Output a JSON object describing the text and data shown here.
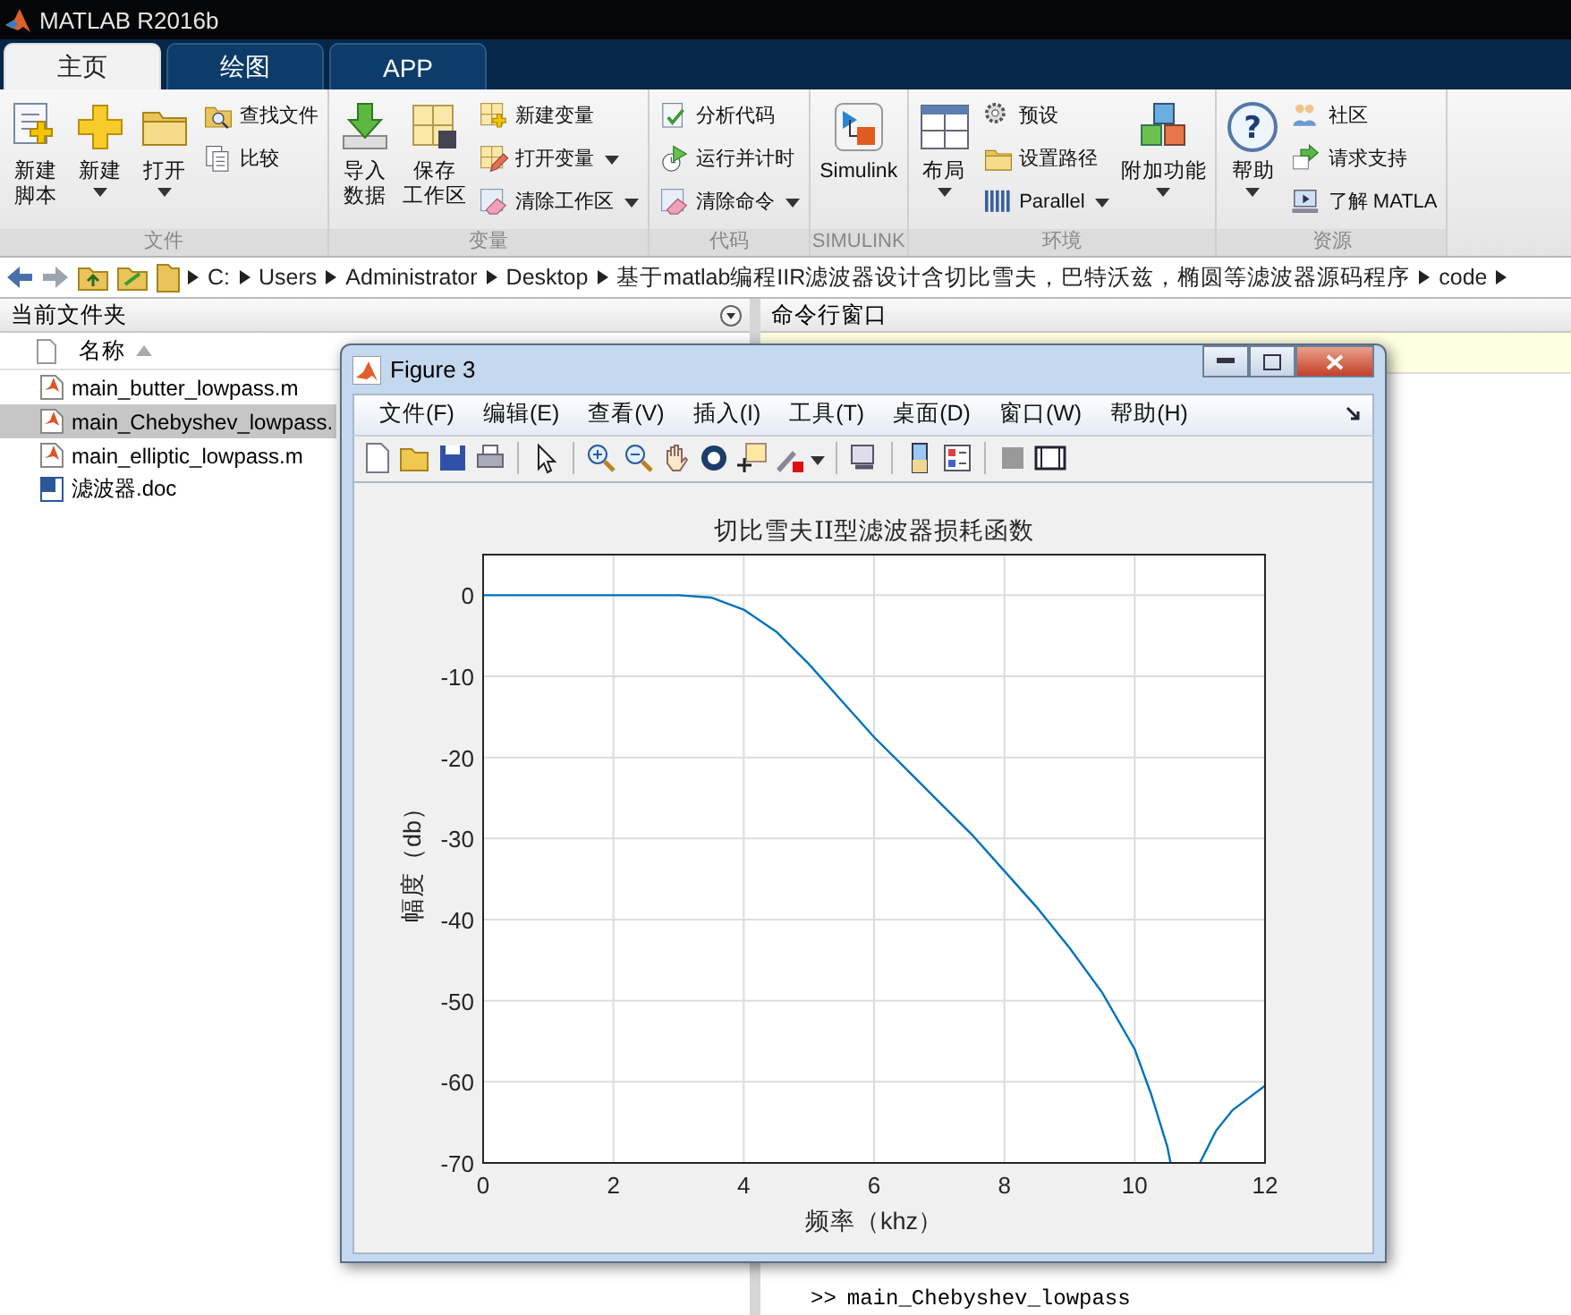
{
  "window": {
    "title": "MATLAB R2016b"
  },
  "tabs": [
    {
      "label": "主页",
      "selected": true
    },
    {
      "label": "绘图",
      "selected": false
    },
    {
      "label": "APP",
      "selected": false
    }
  ],
  "ribbon": [
    {
      "label": "文件",
      "items": [
        {
          "lines": [
            "新建",
            "脚本"
          ],
          "kind": "large",
          "dropdown": false
        },
        {
          "lines": [
            "新建"
          ],
          "kind": "large",
          "dropdown": true
        },
        {
          "lines": [
            "打开"
          ],
          "kind": "large",
          "dropdown": true
        },
        {
          "lines": [
            "查找文件"
          ],
          "kind": "small",
          "dropdown": false
        },
        {
          "lines": [
            "比较"
          ],
          "kind": "small",
          "dropdown": false
        }
      ]
    },
    {
      "label": "变量",
      "items": [
        {
          "lines": [
            "导入",
            "数据"
          ],
          "kind": "large",
          "dropdown": false
        },
        {
          "lines": [
            "保存",
            "工作区"
          ],
          "kind": "large",
          "dropdown": false
        },
        {
          "lines": [
            "新建变量"
          ],
          "kind": "small",
          "dropdown": false
        },
        {
          "lines": [
            "打开变量"
          ],
          "kind": "small",
          "dropdown": true
        },
        {
          "lines": [
            "清除工作区"
          ],
          "kind": "small",
          "dropdown": true
        }
      ]
    },
    {
      "label": "代码",
      "items": [
        {
          "lines": [
            "分析代码"
          ],
          "kind": "small",
          "dropdown": false
        },
        {
          "lines": [
            "运行并计时"
          ],
          "kind": "small",
          "dropdown": false
        },
        {
          "lines": [
            "清除命令"
          ],
          "kind": "small",
          "dropdown": true
        }
      ]
    },
    {
      "label": "SIMULINK",
      "items": [
        {
          "lines": [
            "Simulink"
          ],
          "kind": "large",
          "dropdown": false
        }
      ]
    },
    {
      "label": "环境",
      "items": [
        {
          "lines": [
            "布局"
          ],
          "kind": "large",
          "dropdown": true
        },
        {
          "lines": [
            "预设"
          ],
          "kind": "small",
          "dropdown": false
        },
        {
          "lines": [
            "设置路径"
          ],
          "kind": "small",
          "dropdown": false
        },
        {
          "lines": [
            "Parallel"
          ],
          "kind": "small",
          "dropdown": true
        },
        {
          "lines": [
            "附加功能"
          ],
          "kind": "large",
          "dropdown": true
        }
      ]
    },
    {
      "label": "资源",
      "items": [
        {
          "lines": [
            "帮助"
          ],
          "kind": "large",
          "dropdown": true,
          "glyph": "?"
        },
        {
          "lines": [
            "社区"
          ],
          "kind": "small",
          "dropdown": false
        },
        {
          "lines": [
            "请求支持"
          ],
          "kind": "small",
          "dropdown": false
        },
        {
          "lines": [
            "了解 MATLA"
          ],
          "kind": "small",
          "dropdown": false
        }
      ]
    }
  ],
  "path": [
    "C:",
    "Users",
    "Administrator",
    "Desktop",
    "基于matlab编程IIR滤波器设计含切比雪夫，巴特沃兹，椭圆等滤波器源码程序",
    "code"
  ],
  "file_panel": {
    "title": "当前文件夹",
    "column": "名称",
    "files": [
      {
        "name": "main_butter_lowpass.m",
        "kind": "m",
        "selected": false
      },
      {
        "name": "main_Chebyshev_lowpass.",
        "kind": "m",
        "selected": true
      },
      {
        "name": "main_elliptic_lowpass.m",
        "kind": "m",
        "selected": false
      },
      {
        "name": "滤波器.doc",
        "kind": "doc",
        "selected": false
      }
    ]
  },
  "command_window": {
    "title": "命令行窗口",
    "prompt": ">>",
    "command": "main_Chebyshev_lowpass"
  },
  "figure": {
    "title": "Figure 3",
    "menu": [
      "文件(F)",
      "编辑(E)",
      "查看(V)",
      "插入(I)",
      "工具(T)",
      "桌面(D)",
      "窗口(W)",
      "帮助(H)"
    ],
    "chart_data": {
      "type": "line",
      "title": "切比雪夫II型滤波器损耗函数",
      "xlabel": "频率（khz）",
      "ylabel": "幅度（db）",
      "grid": true,
      "xlim": [
        0,
        12
      ],
      "ylim": [
        -70,
        5
      ],
      "xticks": [
        0,
        2,
        4,
        6,
        8,
        10,
        12
      ],
      "yticks": [
        -70,
        -60,
        -50,
        -40,
        -30,
        -20,
        -10,
        0
      ],
      "x": [
        0,
        1,
        2,
        3,
        3.5,
        4,
        4.5,
        5,
        5.5,
        6,
        6.5,
        7,
        7.5,
        8,
        8.5,
        9,
        9.5,
        10,
        10.25,
        10.5,
        10.55,
        10.8,
        11,
        11.25,
        11.5,
        11.75,
        12
      ],
      "series": [
        {
          "color": "#0072bd",
          "values": [
            0,
            0,
            0,
            0,
            -0.3,
            -1.8,
            -4.5,
            -8.5,
            -13,
            -17.5,
            -21.5,
            -25.5,
            -29.5,
            -34,
            -38.5,
            -43.5,
            -49,
            -56,
            -61.5,
            -68,
            -70,
            null,
            -70,
            -66,
            -63.5,
            -62,
            -60.5
          ]
        }
      ]
    }
  }
}
